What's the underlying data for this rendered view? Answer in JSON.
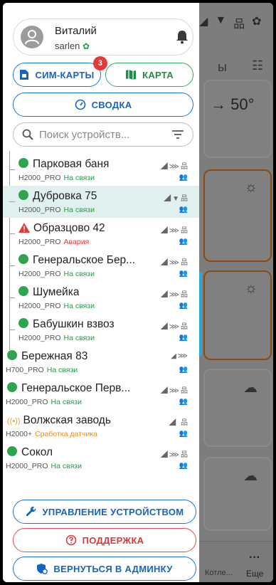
{
  "background": {
    "label": "ы",
    "value": "→ 50°",
    "bottom_tab": "Котле...",
    "more_label": "Еще"
  },
  "user": {
    "name": "Виталий",
    "login": "sarlen"
  },
  "buttons": {
    "sim_cards": "СИМ-КАРТЫ",
    "sim_badge": "3",
    "map": "КАРТА",
    "summary": "СВОДКА",
    "manage": "УПРАВЛЕНИЕ УСТРОЙСТВОМ",
    "support": "ПОДДЕРЖКА",
    "admin": "ВЕРНУТЬСЯ В АДМИНКУ"
  },
  "search": {
    "placeholder": "Поиск устройств..."
  },
  "devices": [
    {
      "name": "Парковая баня",
      "model": "H2000_PRO",
      "status": "На связи"
    },
    {
      "name": "Дубровка 75",
      "model": "H2000_PRO",
      "status": "На связи"
    },
    {
      "name": "Образцово 42",
      "model": "H2000_PRO",
      "status": "Авария"
    },
    {
      "name": "Генеральское Бер...",
      "model": "H2000_PRO",
      "status": "На связи"
    },
    {
      "name": "Шумейка",
      "model": "H2000_PRO",
      "status": "На связи"
    },
    {
      "name": "Бабушкин взвоз",
      "model": "H2000_PRO",
      "status": "На связи"
    },
    {
      "name": "Бережная 83",
      "model": "H700_PRO",
      "status": "На связи"
    },
    {
      "name": "Генеральское Перв...",
      "model": "H2000_PRO",
      "status": "На связи"
    },
    {
      "name": "Волжская заводь",
      "model": "H2000+",
      "status": "Сработка датчика"
    },
    {
      "name": "Сокол",
      "model": "H2000_PRO",
      "status": "На связи"
    }
  ],
  "colors": {
    "online": "#1e9e45",
    "alarm": "#e23b3b",
    "sensor": "#f08a12",
    "accent_blue": "#1565c0",
    "selected_row": "#dff0ef"
  }
}
